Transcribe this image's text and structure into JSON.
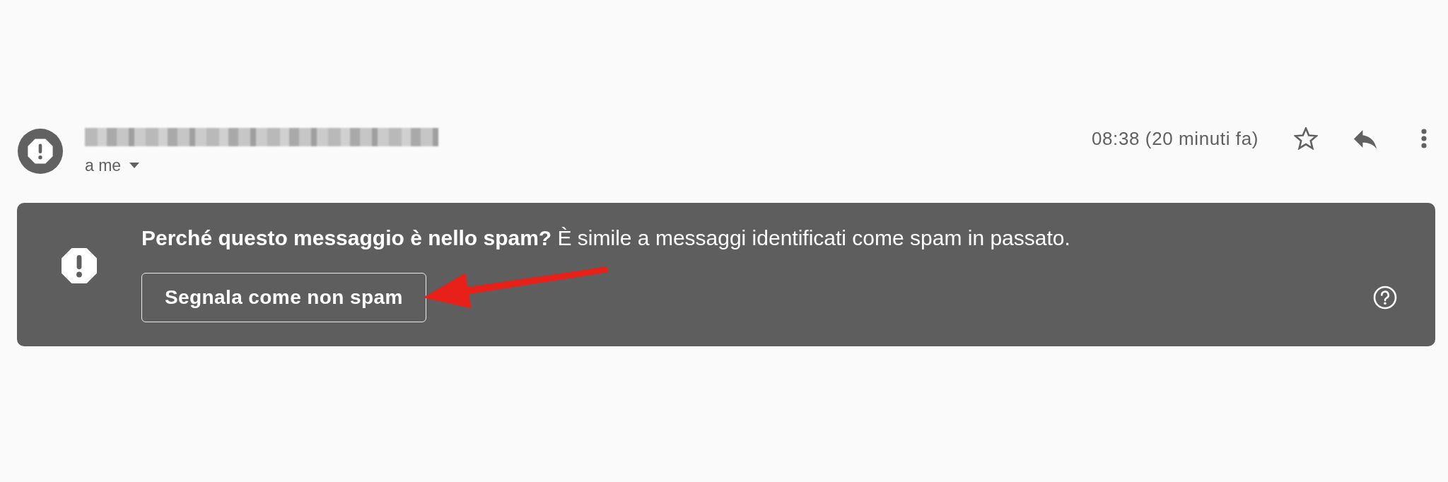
{
  "message_header": {
    "recipient": "a me",
    "time": "08:38 (20 minuti fa)",
    "starred": false
  },
  "spam_banner": {
    "message": "**Perché questo messaggio è nello spam?** È simile a messaggi identificati come spam in passato.",
    "button": "Segnala come non spam"
  }
}
